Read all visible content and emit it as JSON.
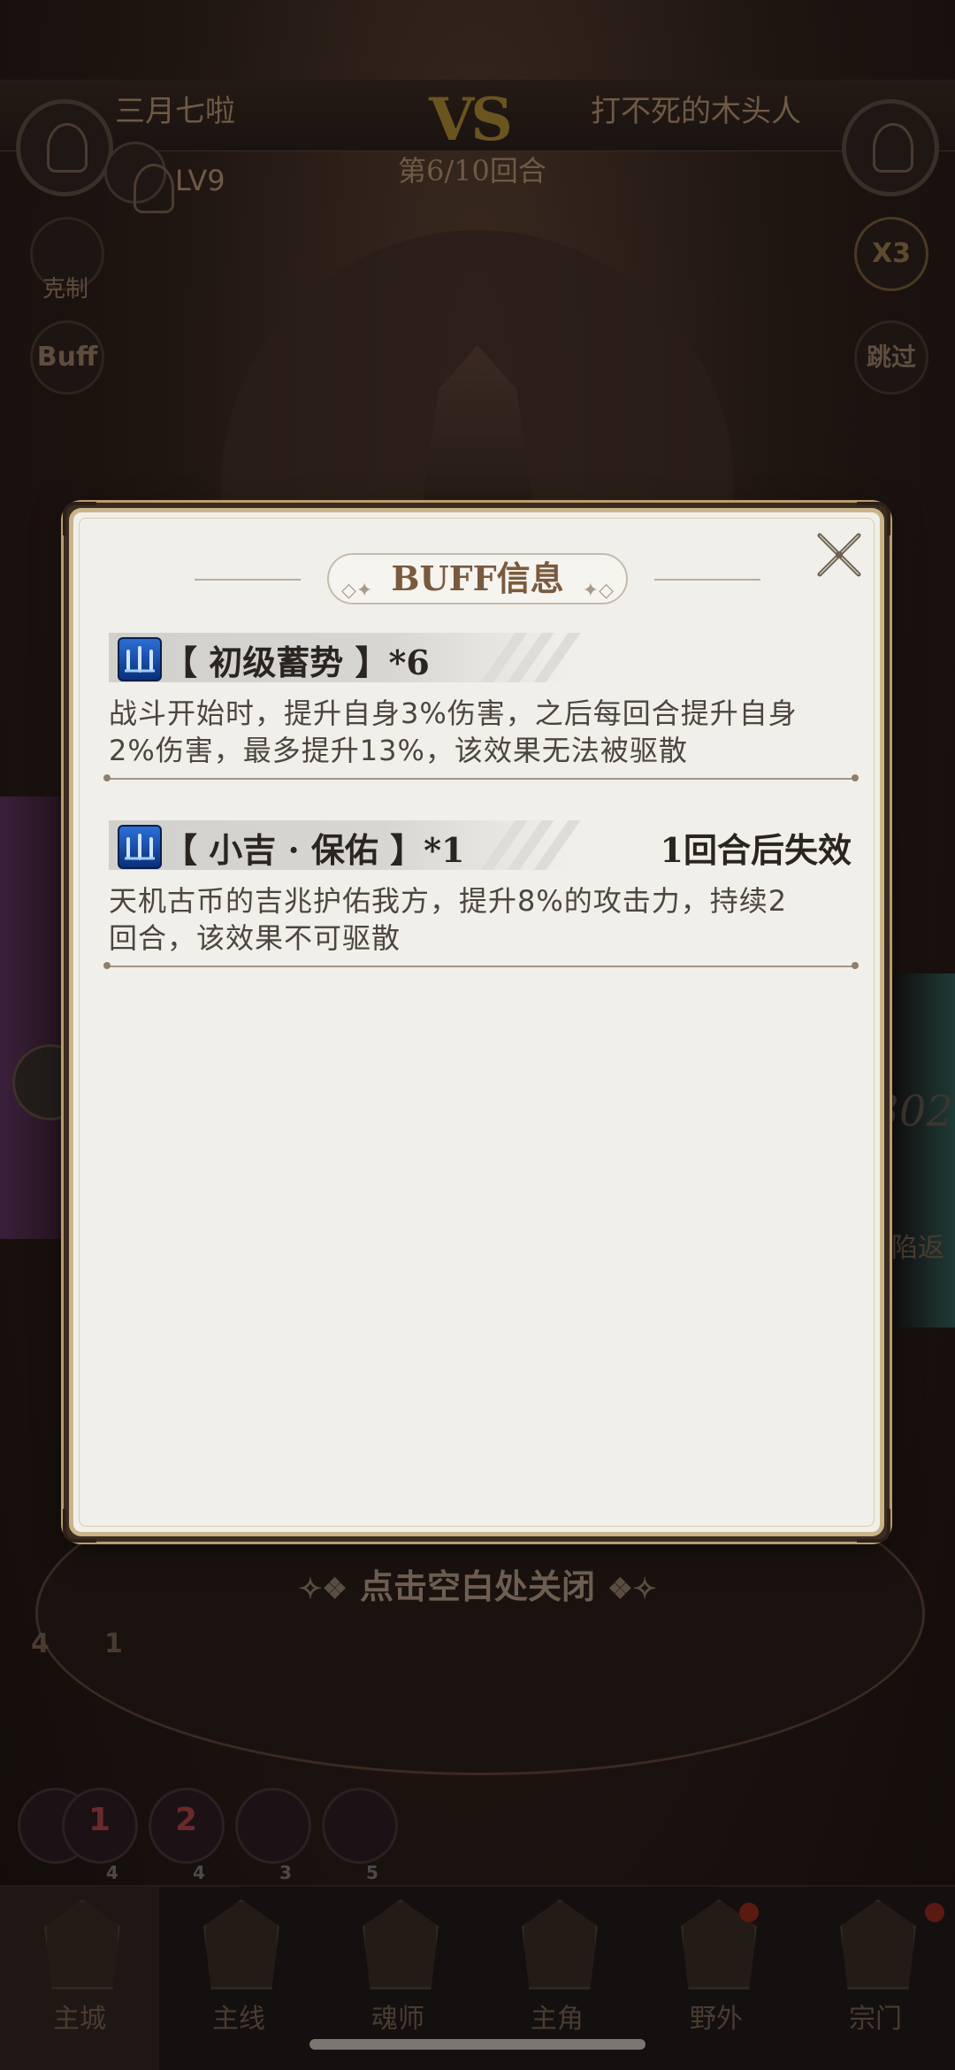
{
  "battle": {
    "player_left": "三月七啦",
    "player_right": "打不死的木头人",
    "vs": "VS",
    "round": "第6/10回合",
    "level": "LV9",
    "counter_label": "克制",
    "buff_button": "Buff",
    "speed": "X3",
    "skip": "跳过",
    "side_number": "302",
    "side_tag": "陷返",
    "close_hint": "点击空白处关闭",
    "team_counts": [
      "4",
      "1"
    ],
    "hero_numbers": [
      "1",
      "2"
    ],
    "hero_levels": [
      "4",
      "4",
      "3",
      "5"
    ]
  },
  "dialog": {
    "title": "BUFF信息",
    "buffs": [
      {
        "name": "【 初级蓄势 】*6",
        "expire": "",
        "description": "战斗开始时，提升自身3%伤害，之后每回合提升自身2%伤害，最多提升13%，该效果无法被驱散"
      },
      {
        "name": "【 小吉 · 保佑 】*1",
        "expire": "1回合后失效",
        "description": "天机古币的吉兆护佑我方，提升8%的攻击力，持续2回合，该效果不可驱散"
      }
    ]
  },
  "nav": {
    "items": [
      {
        "label": "主城",
        "icon": "castle-icon"
      },
      {
        "label": "主线",
        "icon": "mainline-icon"
      },
      {
        "label": "魂师",
        "icon": "soul-master-icon"
      },
      {
        "label": "主角",
        "icon": "hero-icon"
      },
      {
        "label": "野外",
        "icon": "wild-icon"
      },
      {
        "label": "宗门",
        "icon": "sect-icon"
      }
    ]
  },
  "colors": {
    "dialog_bg": "#f1efe9",
    "dialog_border": "#c9b48a",
    "title": "#7a5a3e",
    "buff_icon": "#2b6fd6"
  }
}
